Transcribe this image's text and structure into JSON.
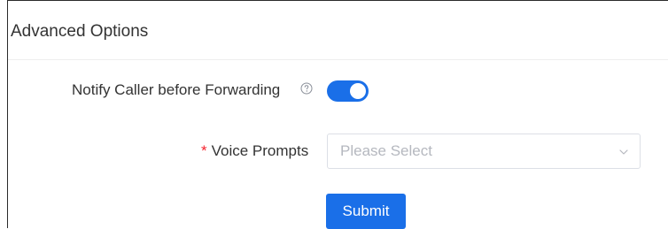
{
  "panel": {
    "title": "Advanced Options"
  },
  "fields": {
    "notify_label": "Notify Caller before Forwarding",
    "notify_enabled": true,
    "voice_prompts_required_mark": "*",
    "voice_prompts_label": "Voice Prompts",
    "voice_prompts_placeholder": "Please Select"
  },
  "actions": {
    "submit_label": "Submit"
  },
  "colors": {
    "accent": "#1a6fe8",
    "required": "#f5222d",
    "placeholder": "#b5b8bf",
    "border": "#dcdfe6"
  },
  "icons": {
    "help": "help-circle-icon",
    "dropdown": "chevron-down-icon"
  }
}
